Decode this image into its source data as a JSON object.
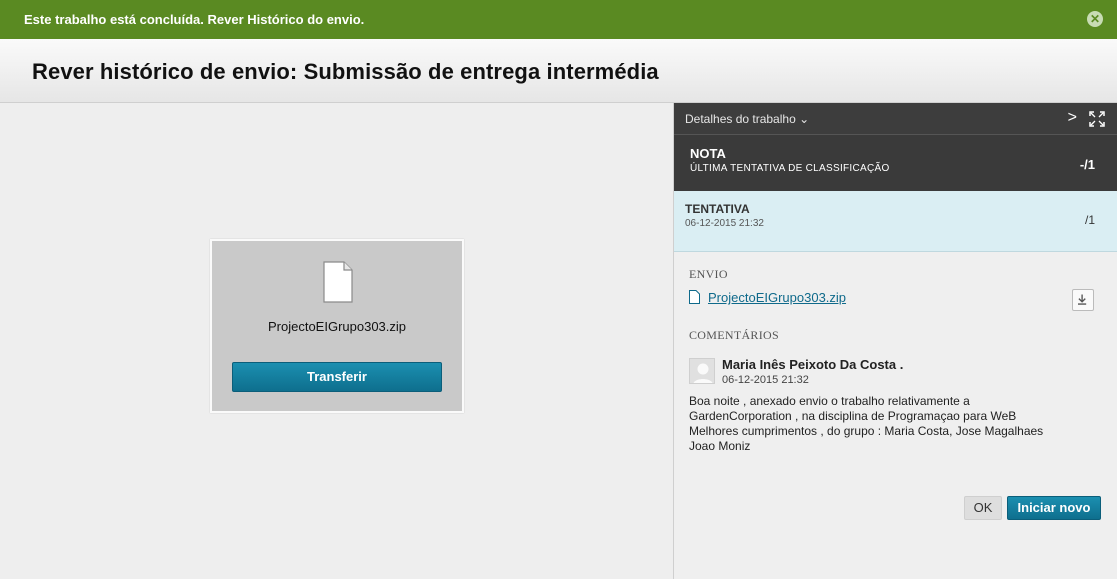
{
  "banner": {
    "text": "Este trabalho está concluída. Rever Histórico do envio.",
    "close_glyph": "✕"
  },
  "page": {
    "title": "Rever histórico de envio: Submissão de entrega intermédia"
  },
  "preview": {
    "file_name": "ProjectoEIGrupo303.zip",
    "download_label": "Transferir",
    "icon": "document-icon"
  },
  "details": {
    "header_label": "Detalhes do trabalho ⌄",
    "next_glyph": ">",
    "expand_icon": "expand-icon"
  },
  "grade": {
    "title": "NOTA",
    "subtitle": "ÚLTIMA TENTATIVA DE CLASSIFICAÇÃO",
    "value": "-/1"
  },
  "attempt": {
    "title": "TENTATIVA",
    "date": "06-12-2015 21:32",
    "value": "/1"
  },
  "submission": {
    "label": "ENVIO",
    "file_name": "ProjectoEIGrupo303.zip",
    "download_icon": "download-icon"
  },
  "comments": {
    "label": "COMENTÁRIOS",
    "author": "Maria Inês Peixoto Da Costa .",
    "date": "06-12-2015 21:32",
    "lines": [
      "Boa noite , anexado envio o trabalho relativamente a",
      "GardenCorporation , na disciplina de Programaçao para WeB",
      "Melhores cumprimentos , do grupo :  Maria Costa,  Jose Magalhaes",
      "Joao Moniz"
    ]
  },
  "actions": {
    "ok_label": "OK",
    "new_label": "Iniciar novo"
  },
  "colors": {
    "banner": "#5a8a22",
    "accent": "#0e6f8e",
    "attempt_bg": "#daeef3",
    "dark_panel": "#3a3a3a"
  }
}
